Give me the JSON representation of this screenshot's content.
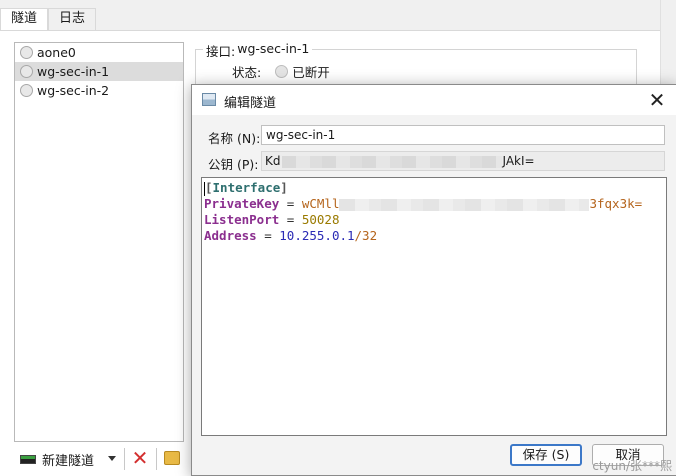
{
  "tabs": [
    {
      "label": "隧道",
      "active": true
    },
    {
      "label": "日志",
      "active": false
    }
  ],
  "tunnels": [
    {
      "name": "aone0",
      "selected": false
    },
    {
      "name": "wg-sec-in-1",
      "selected": true
    },
    {
      "name": "wg-sec-in-2",
      "selected": false
    }
  ],
  "toolbar": {
    "new_tunnel_label": "新建隧道",
    "new_icon": "tunnel-add-icon",
    "delete_icon": "delete-x-icon",
    "export_icon": "folder-icon"
  },
  "detail": {
    "interface_label": "接口:",
    "interface_name": "wg-sec-in-1",
    "status_label": "状态:",
    "status_value": "已断开"
  },
  "dialog": {
    "title": "编辑隧道",
    "name_label": "名称 (N):",
    "name_value": "wg-sec-in-1",
    "pubkey_label": "公钥 (P):",
    "pubkey_prefix": "Kd",
    "pubkey_suffix": "JAkI=",
    "config": {
      "section": "Interface",
      "private_key_key": "PrivateKey",
      "private_key_prefix": "wCMll",
      "private_key_suffix": "3fqx3k=",
      "listen_port_key": "ListenPort",
      "listen_port_value": "50028",
      "address_key": "Address",
      "address_ip": "10.255.0.1",
      "address_cidr": "/32"
    },
    "save_label": "保存 (S)",
    "cancel_label": "取消"
  },
  "watermark": "ctyun/张***熙",
  "colors": {
    "section": "#2e6f6f",
    "key": "#8b2f8f",
    "ip": "#2b2bb5",
    "number": "#9a7a00",
    "primary_border": "#3c78c8",
    "delete": "#d32f2f"
  }
}
